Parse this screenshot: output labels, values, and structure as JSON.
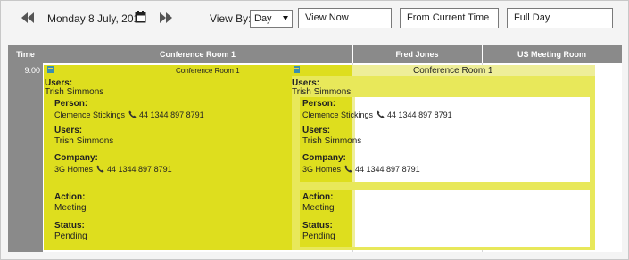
{
  "toolbar": {
    "date_label": "Monday 8 July, 2019",
    "view_by_label": "View By:",
    "view_by_selected": "Day",
    "view_now_label": "View Now",
    "from_current_time_label": "From Current Time",
    "full_day_label": "Full Day"
  },
  "grid": {
    "time_header": "Time",
    "columns": [
      "Conference Room 1",
      "Fred Jones",
      "US Meeting Room"
    ],
    "time_slots": [
      "9:00"
    ]
  },
  "appointment_a": {
    "title": "Conference Room 1",
    "users_label": "Users:",
    "users_value": "Trish Simmons",
    "person_label": "Person:",
    "person_name": "Clemence Stickings",
    "person_phone": "44 1344 897 8791",
    "users2_label": "Users:",
    "users2_value": "Trish Simmons",
    "company_label": "Company:",
    "company_name": "3G Homes",
    "company_phone": "44 1344 897 8791",
    "action_label": "Action:",
    "action_value": "Meeting",
    "status_label": "Status:",
    "status_value": "Pending"
  },
  "appointment_b": {
    "title": "Conference Room 1",
    "users_label": "Users:",
    "users_value": "Trish Simmons",
    "person_label": "Person:",
    "person_name": "Clemence Stickings",
    "person_phone": "44 1344 897 8791",
    "users2_label": "Users:",
    "users2_value": "Trish Simmons",
    "company_label": "Company:",
    "company_name": "3G Homes",
    "company_phone": "44 1344 897 8791",
    "action_label": "Action:",
    "action_value": "Meeting",
    "status_label": "Status:",
    "status_value": "Pending"
  },
  "colors": {
    "header_gray": "#8a8a8a",
    "appointment_lime": "#dede1e",
    "appointment_lime_light": "#e8e85a",
    "nav_arrow": "#555555"
  },
  "icons": {
    "prev": "double-chevron-left-icon",
    "next": "double-chevron-right-icon",
    "calendar": "calendar-icon",
    "phone": "phone-icon",
    "appointment": "appointment-icon"
  }
}
